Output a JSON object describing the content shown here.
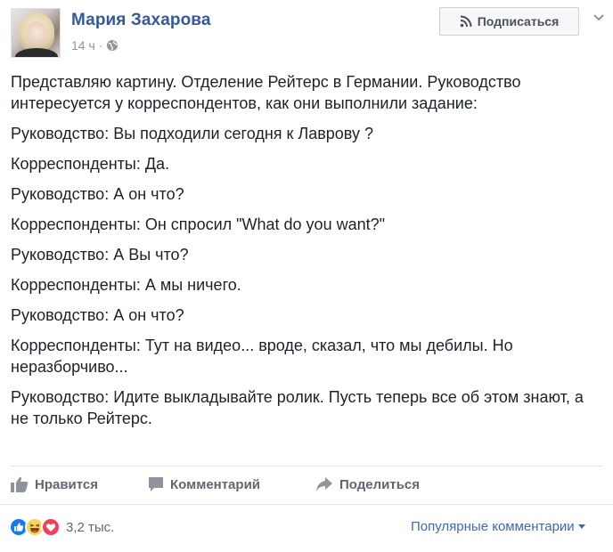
{
  "header": {
    "author": "Мария Захарова",
    "time": "14 ч",
    "separator": "·",
    "subscribe_label": "Подписаться"
  },
  "post": {
    "paragraphs": [
      "Представляю картину. Отделение Рейтерс в Германии. Руководство интересуется у корреспондентов, как они выполнили задание:",
      "Руководство: Вы подходили сегодня к Лаврову ?",
      "Корреспонденты: Да.",
      "Руководство: А он что?",
      "Корреспонденты: Он спросил \"What do you want?\"",
      "Руководство: А Вы что?",
      "Корреспонденты: А мы ничего.",
      "Руководство: А он что?",
      "Корреспонденты: Тут на видео... вроде, сказал, что мы дебилы. Но неразборчиво...",
      "Руководство: Идите выкладывайте ролик. Пусть теперь все об этом знают, а не только Рейтерс."
    ]
  },
  "actions": {
    "like": "Нравится",
    "comment": "Комментарий",
    "share": "Поделиться"
  },
  "reactions": {
    "icons": [
      "like-reaction-icon",
      "haha-reaction-icon",
      "love-reaction-icon"
    ],
    "count": "3,2 тыс."
  },
  "comments": {
    "sort_label": "Популярные комментарии"
  },
  "colors": {
    "author": "#365899",
    "link": "#4267b2",
    "muted": "#90949c",
    "like_blue": "#1877f2",
    "love_red": "#f33e58",
    "haha_yellow": "#f7d55a"
  }
}
